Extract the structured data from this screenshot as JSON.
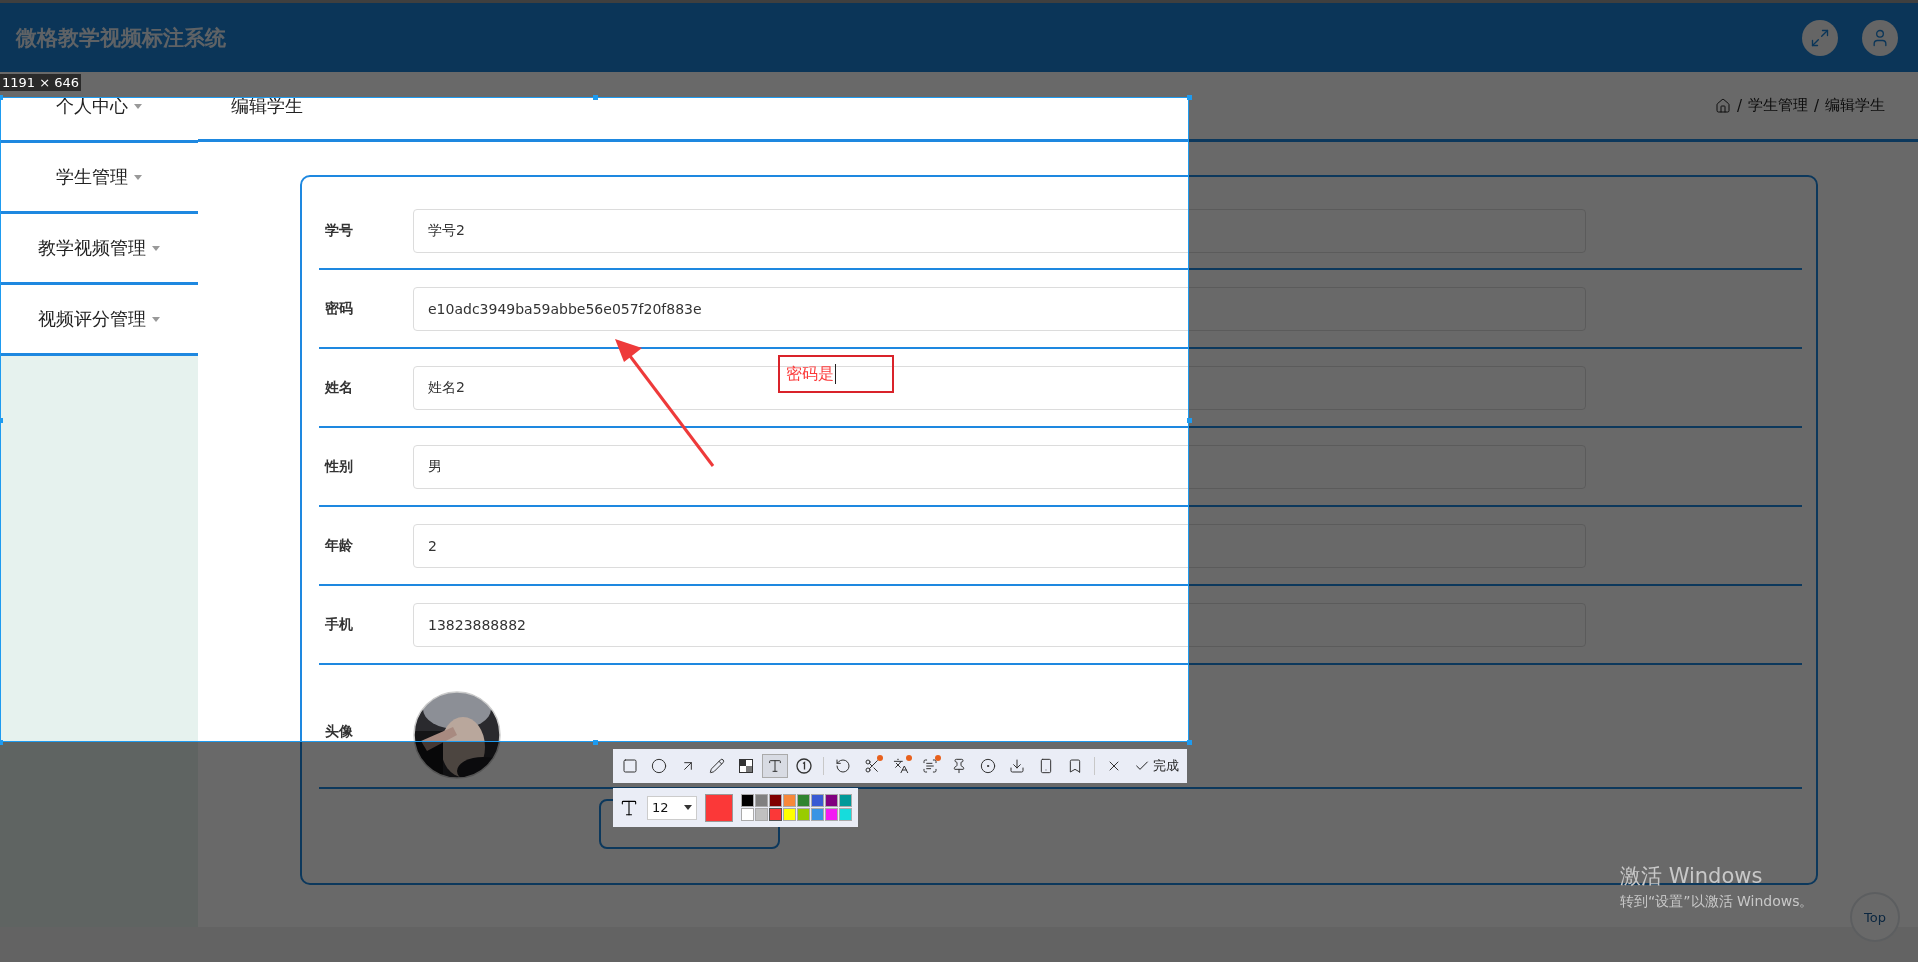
{
  "header": {
    "title": "微格教学视频标注系统"
  },
  "sidebar": {
    "items": [
      {
        "label": "个人中心",
        "expanded": false
      },
      {
        "label": "学生管理",
        "expanded": false
      },
      {
        "label": "教学视频管理",
        "expanded": false
      },
      {
        "label": "视频评分管理",
        "expanded": false
      }
    ]
  },
  "page_title": "编辑学生",
  "breadcrumb": {
    "separator": "/",
    "items": [
      "学生管理",
      "编辑学生"
    ]
  },
  "form": {
    "fields": [
      {
        "label": "学号",
        "value": "学号2"
      },
      {
        "label": "密码",
        "value": "e10adc3949ba59abbe56e057f20f883e"
      },
      {
        "label": "姓名",
        "value": "姓名2"
      },
      {
        "label": "性别",
        "value": "男"
      },
      {
        "label": "年龄",
        "value": "2"
      },
      {
        "label": "手机",
        "value": "13823888882"
      }
    ],
    "avatar_label": "头像"
  },
  "capture": {
    "size_label": "1191 × 646",
    "annotation_text": "密码是",
    "tools": [
      {
        "kind": "rectangle",
        "selected": false,
        "badge": false
      },
      {
        "kind": "ellipse",
        "selected": false,
        "badge": false
      },
      {
        "kind": "arrow",
        "selected": false,
        "badge": false
      },
      {
        "kind": "pencil",
        "selected": false,
        "badge": false
      },
      {
        "kind": "mosaic",
        "selected": false,
        "badge": false
      },
      {
        "kind": "text",
        "selected": true,
        "badge": false
      },
      {
        "kind": "number",
        "selected": false,
        "badge": false
      },
      {
        "kind": "divider"
      },
      {
        "kind": "undo",
        "selected": false,
        "badge": false
      },
      {
        "kind": "cut",
        "selected": false,
        "badge": true
      },
      {
        "kind": "translate",
        "selected": false,
        "badge": true
      },
      {
        "kind": "ocr",
        "selected": false,
        "badge": true
      },
      {
        "kind": "pin",
        "selected": false,
        "badge": false
      },
      {
        "kind": "record",
        "selected": false,
        "badge": false
      },
      {
        "kind": "download",
        "selected": false,
        "badge": false
      },
      {
        "kind": "phone",
        "selected": false,
        "badge": false
      },
      {
        "kind": "bookmark",
        "selected": false,
        "badge": false
      },
      {
        "kind": "divider"
      },
      {
        "kind": "close",
        "selected": false,
        "badge": false
      }
    ],
    "done_label": "完成",
    "font_size": "12",
    "palette": [
      {
        "color": "#000000",
        "selected": false
      },
      {
        "color": "#808080",
        "selected": false
      },
      {
        "color": "#800000",
        "selected": false
      },
      {
        "color": "#f7883a",
        "selected": false
      },
      {
        "color": "#308430",
        "selected": false
      },
      {
        "color": "#385ad3",
        "selected": false
      },
      {
        "color": "#800080",
        "selected": false
      },
      {
        "color": "#009999",
        "selected": false
      },
      {
        "color": "#ffffff",
        "selected": false
      },
      {
        "color": "#c0c0c0",
        "selected": false
      },
      {
        "color": "#fb3838",
        "selected": true
      },
      {
        "color": "#ffff00",
        "selected": false
      },
      {
        "color": "#99cc00",
        "selected": false
      },
      {
        "color": "#3894e4",
        "selected": false
      },
      {
        "color": "#f31bf3",
        "selected": false
      },
      {
        "color": "#16dcdc",
        "selected": false
      }
    ]
  },
  "watermark": {
    "title": "激活 Windows",
    "subtitle": "转到“设置”以激活 Windows。"
  },
  "top_button": "Top"
}
